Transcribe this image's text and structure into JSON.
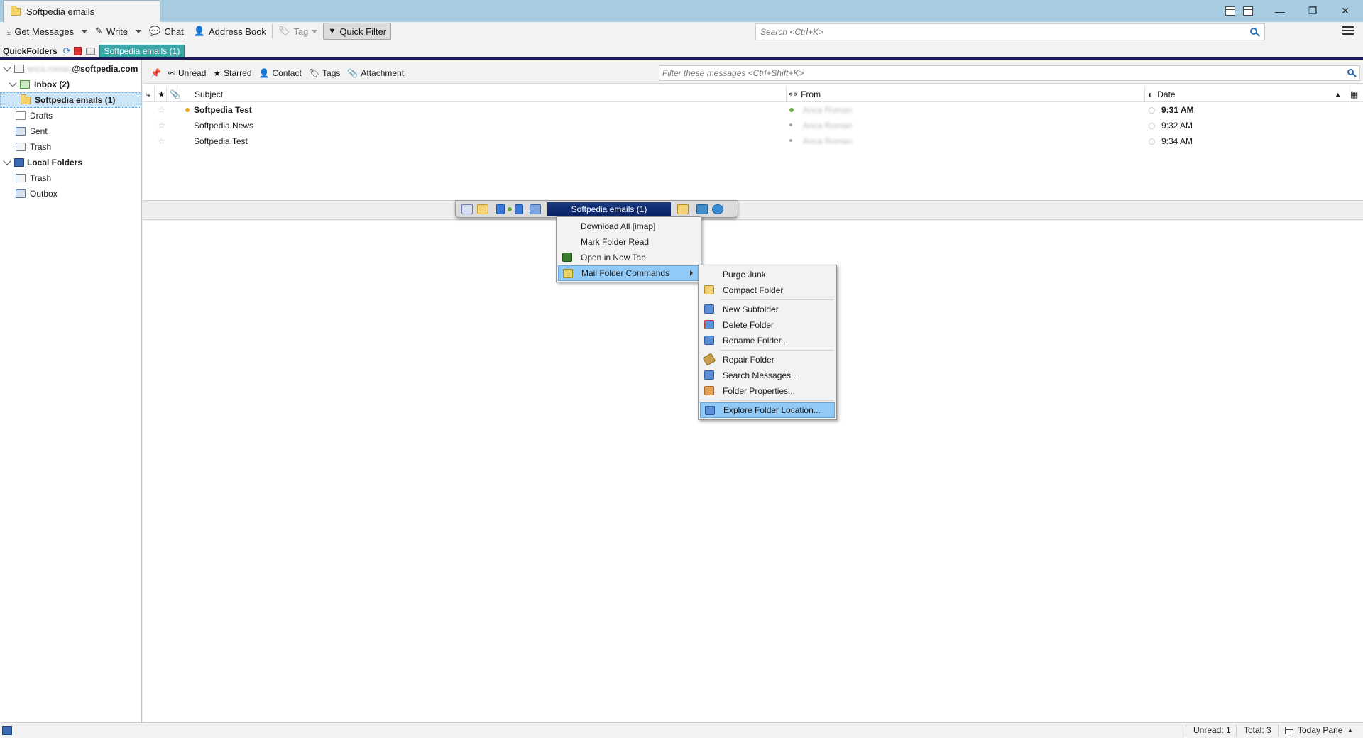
{
  "window": {
    "tab_title": "Softpedia emails",
    "controls": {
      "minimize": "—",
      "restore": "❐",
      "close": "✕"
    }
  },
  "toolbar": {
    "get_messages": "Get Messages",
    "write": "Write",
    "chat": "Chat",
    "address_book": "Address Book",
    "tag": "Tag",
    "quick_filter": "Quick Filter",
    "search_placeholder": "Search <Ctrl+K>"
  },
  "quickfolders": {
    "label": "QuickFolders",
    "active_tab": "Softpedia emails (1)"
  },
  "folder_pane": {
    "account_domain": "@softpedia.com",
    "account_user_blurred": "anca.roman",
    "inbox": "Inbox (2)",
    "softpedia_emails": "Softpedia emails (1)",
    "drafts": "Drafts",
    "sent": "Sent",
    "trash": "Trash",
    "local_folders": "Local Folders",
    "local_trash": "Trash",
    "outbox": "Outbox"
  },
  "filter_bar": {
    "unread": "Unread",
    "starred": "Starred",
    "contact": "Contact",
    "tags": "Tags",
    "attachment": "Attachment",
    "filter_placeholder": "Filter these messages <Ctrl+Shift+K>"
  },
  "thread": {
    "columns": {
      "subject": "Subject",
      "from": "From",
      "date": "Date"
    },
    "rows": [
      {
        "subject": "Softpedia Test",
        "from": "Anca Roman",
        "date": "9:31 AM",
        "unread": true
      },
      {
        "subject": "Softpedia News",
        "from": "Anca Roman",
        "date": "9:32 AM",
        "unread": false
      },
      {
        "subject": "Softpedia Test",
        "from": "Anca Roman",
        "date": "9:34 AM",
        "unread": false
      }
    ]
  },
  "qf_float": {
    "title": "Softpedia emails (1)"
  },
  "context_menu": {
    "items": [
      "Download All [imap]",
      "Mark Folder Read",
      "Open in New Tab",
      "Mail Folder Commands"
    ]
  },
  "submenu": {
    "items": [
      "Purge Junk",
      "Compact Folder",
      "New Subfolder",
      "Delete Folder",
      "Rename Folder...",
      "Repair Folder",
      "Search Messages...",
      "Folder Properties...",
      "Explore Folder Location..."
    ]
  },
  "statusbar": {
    "unread": "Unread: 1",
    "total": "Total: 3",
    "today_pane": "Today Pane"
  },
  "colors": {
    "titlebar": "#a7cbe0",
    "quickfolder_tab": "#3aa6a8",
    "menu_highlight": "#91c9f7",
    "selected_folder": "#cde6f7"
  }
}
